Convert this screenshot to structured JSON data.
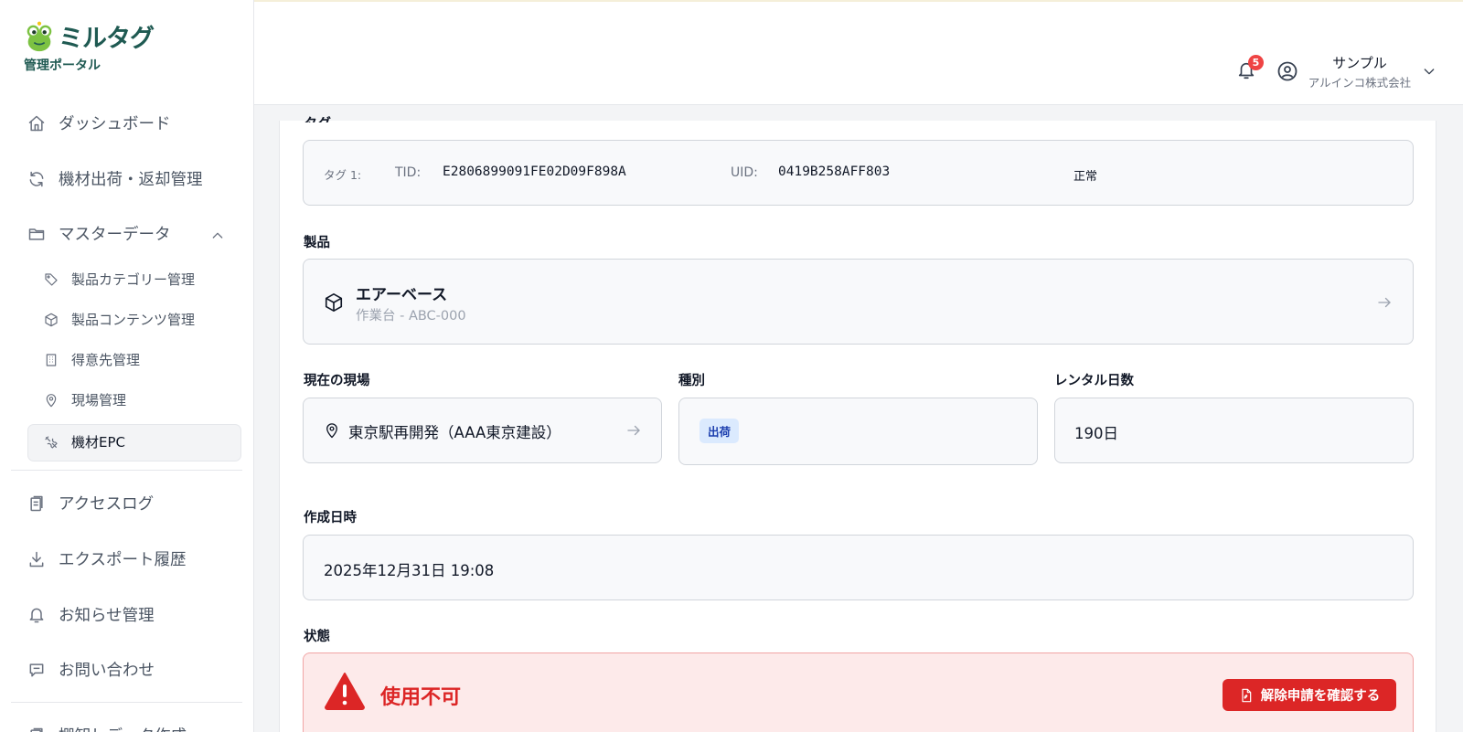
{
  "app": {
    "logo_text": "ミルタグ",
    "logo_sub": "管理ポータル"
  },
  "sidebar": {
    "items": [
      {
        "label": "ダッシュボード",
        "icon": "home-icon"
      },
      {
        "label": "機材出荷・返却管理",
        "icon": "refresh-icon"
      },
      {
        "label": "マスターデータ",
        "icon": "folder-icon",
        "expanded": true
      },
      {
        "label": "アクセスログ",
        "icon": "clipboard-icon"
      },
      {
        "label": "エクスポート履歴",
        "icon": "download-icon"
      },
      {
        "label": "お知らせ管理",
        "icon": "bell-icon"
      },
      {
        "label": "お問い合わせ",
        "icon": "message-icon"
      },
      {
        "label": "棚卸しデータ作成",
        "icon": "clipboard-icon"
      }
    ],
    "sub_items": [
      {
        "label": "製品カテゴリー管理",
        "icon": "tag-icon"
      },
      {
        "label": "製品コンテンツ管理",
        "icon": "box-icon"
      },
      {
        "label": "得意先管理",
        "icon": "building-icon"
      },
      {
        "label": "現場管理",
        "icon": "map-pin-icon"
      },
      {
        "label": "機材EPC",
        "icon": "tools-icon",
        "active": true
      }
    ]
  },
  "header": {
    "notification_count": "5",
    "user_name": "サンプル",
    "user_company": "アルインコ株式会社"
  },
  "detail": {
    "tag_row": {
      "tag_label": "タグ 1:",
      "tid_label": "TID:",
      "tid_value": "E2806899091FE02D09F898A",
      "uid_label": "UID:",
      "uid_value": "0419B258AFF803",
      "status": "正常"
    },
    "product": {
      "label": "製品",
      "name": "エアーベース",
      "sub": "作業台 - ABC-000"
    },
    "site": {
      "label": "現在の現場",
      "value": "東京駅再開発（AAA東京建設）"
    },
    "type": {
      "label": "種別",
      "value": "出荷"
    },
    "rental_days": {
      "label": "レンタル日数",
      "value": "190日"
    },
    "created": {
      "label": "作成日時",
      "value": "2025年12月31日 19:08"
    },
    "state": {
      "label": "状態",
      "value": "使用不可",
      "button_label": "解除申請を確認する"
    }
  },
  "colors": {
    "brand": "#1f5a52",
    "danger": "#dc2626",
    "danger_bg": "#fdeaea",
    "pill_bg": "#dbeafe",
    "pill_text": "#1e40af"
  }
}
